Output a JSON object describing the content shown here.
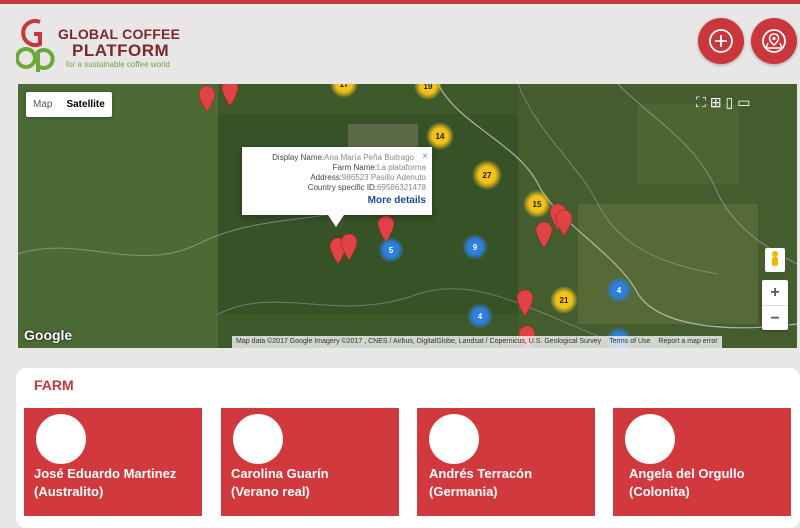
{
  "brand": {
    "line1": "GLOBAL COFFEE",
    "line2": "PLATFORM",
    "tagline": "for a sustainable coffee world",
    "accent": "#c9363b",
    "green": "#6aaa3a"
  },
  "header": {
    "add_icon": "plus-circle-icon",
    "map_pin_icon": "map-location-icon"
  },
  "map": {
    "map_tab": "Map",
    "satellite_tab": "Satellite",
    "google_logo": "Google",
    "attribution": "Map data ©2017 Google Imagery ©2017 , CNES / Airbus, DigitalGlobe, Landsat / Copernicus, U.S. Geological Survey",
    "terms": "Terms of Use",
    "report": "Report a map error",
    "zoom_in": "+",
    "zoom_out": "−",
    "clusters": [
      {
        "label": "17",
        "color": "yellow"
      },
      {
        "label": "19",
        "color": "yellow"
      },
      {
        "label": "14",
        "color": "yellow"
      },
      {
        "label": "27",
        "color": "yellow"
      },
      {
        "label": "15",
        "color": "yellow"
      },
      {
        "label": "21",
        "color": "yellow"
      },
      {
        "label": "5",
        "color": "blue"
      },
      {
        "label": "9",
        "color": "blue"
      },
      {
        "label": "4",
        "color": "blue"
      },
      {
        "label": "4",
        "color": "blue"
      }
    ],
    "info": {
      "display_name_label": "Display Name:",
      "display_name_value": "Ana María Peña Buitrago",
      "farm_name_label": "Farm Name:",
      "farm_name_value": "La plataforma",
      "address_label": "Address:",
      "address_value": "986523 Pasillo Adenuto",
      "country_id_label": "Country specific ID:",
      "country_id_value": "69586321478",
      "more": "More details",
      "close": "×"
    }
  },
  "farm": {
    "title": "FARM",
    "cards": [
      {
        "name": "José Eduardo Martinez",
        "farm": "(Australito)"
      },
      {
        "name": "Carolina Guarín",
        "farm": "(Verano real)"
      },
      {
        "name": "Andrés Terracón",
        "farm": "(Germania)"
      },
      {
        "name": "Angela del Orgullo",
        "farm": "(Colonita)"
      }
    ]
  }
}
